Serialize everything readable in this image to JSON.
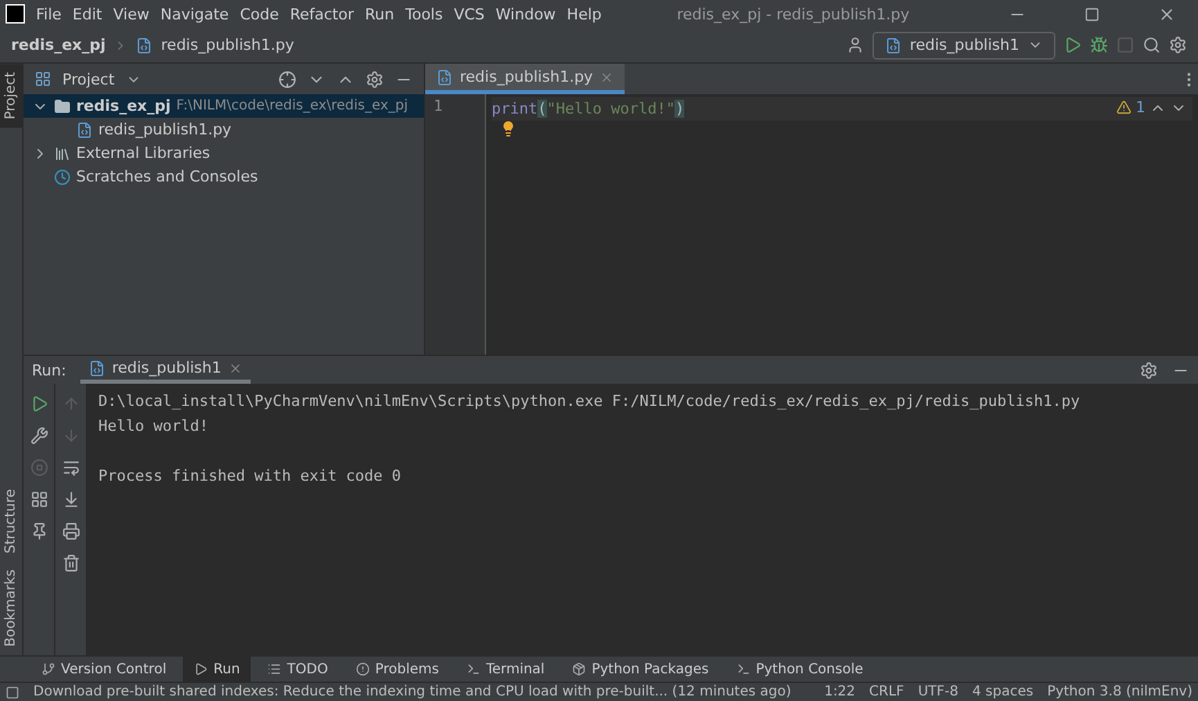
{
  "title_bar": {
    "menu": [
      "File",
      "Edit",
      "View",
      "Navigate",
      "Code",
      "Refactor",
      "Run",
      "Tools",
      "VCS",
      "Window",
      "Help"
    ],
    "title": "redis_ex_pj - redis_publish1.py"
  },
  "nav_bar": {
    "breadcrumbs": [
      "redis_ex_pj",
      "redis_publish1.py"
    ],
    "run_config": "redis_publish1"
  },
  "side_stripe": {
    "top": [
      {
        "label": "Project",
        "selected": true
      }
    ],
    "bottom": [
      {
        "label": "Structure",
        "selected": false
      },
      {
        "label": "Bookmarks",
        "selected": false
      }
    ]
  },
  "project": {
    "title": "Project",
    "tree": [
      {
        "label": "redis_ex_pj",
        "path": "F:\\NILM\\code\\redis_ex\\redis_ex_pj",
        "kind": "folder",
        "expanded": true,
        "selected": true,
        "children": [
          {
            "label": "redis_publish1.py",
            "kind": "python",
            "selected": false
          }
        ]
      },
      {
        "label": "External Libraries",
        "kind": "libraries",
        "expanded": false,
        "selected": false
      },
      {
        "label": "Scratches and Consoles",
        "kind": "scratches",
        "selected": false
      }
    ]
  },
  "editor": {
    "tabs": [
      {
        "label": "redis_publish1.py",
        "selected": true
      }
    ],
    "warnings": "1",
    "lines": [
      {
        "number": "1",
        "tokens": [
          {
            "text": "print",
            "kind": "builtin"
          },
          {
            "text": "(",
            "kind": "paren"
          },
          {
            "text": "\"Hello world!\"",
            "kind": "string"
          },
          {
            "text": ")",
            "kind": "paren"
          }
        ]
      }
    ]
  },
  "run": {
    "label": "Run:",
    "tabs": [
      {
        "label": "redis_publish1",
        "selected": true
      }
    ],
    "output": [
      "D:\\local_install\\PyCharmVenv\\nilmEnv\\Scripts\\python.exe F:/NILM/code/redis_ex/redis_ex_pj/redis_publish1.py",
      "Hello world!"
    ],
    "exit_message": "Process finished with exit code 0"
  },
  "tool_tabs": [
    {
      "label": "Version Control",
      "selected": false
    },
    {
      "label": "Run",
      "selected": true
    },
    {
      "label": "TODO",
      "selected": false
    },
    {
      "label": "Problems",
      "selected": false
    },
    {
      "label": "Terminal",
      "selected": false
    },
    {
      "label": "Python Packages",
      "selected": false
    },
    {
      "label": "Python Console",
      "selected": false
    }
  ],
  "status_bar": {
    "message": "Download pre-built shared indexes: Reduce the indexing time and CPU load with pre-built... (12 minutes ago)",
    "items": [
      "1:22",
      "CRLF",
      "UTF-8",
      "4 spaces",
      "Python 3.8 (nilmEnv)"
    ]
  }
}
